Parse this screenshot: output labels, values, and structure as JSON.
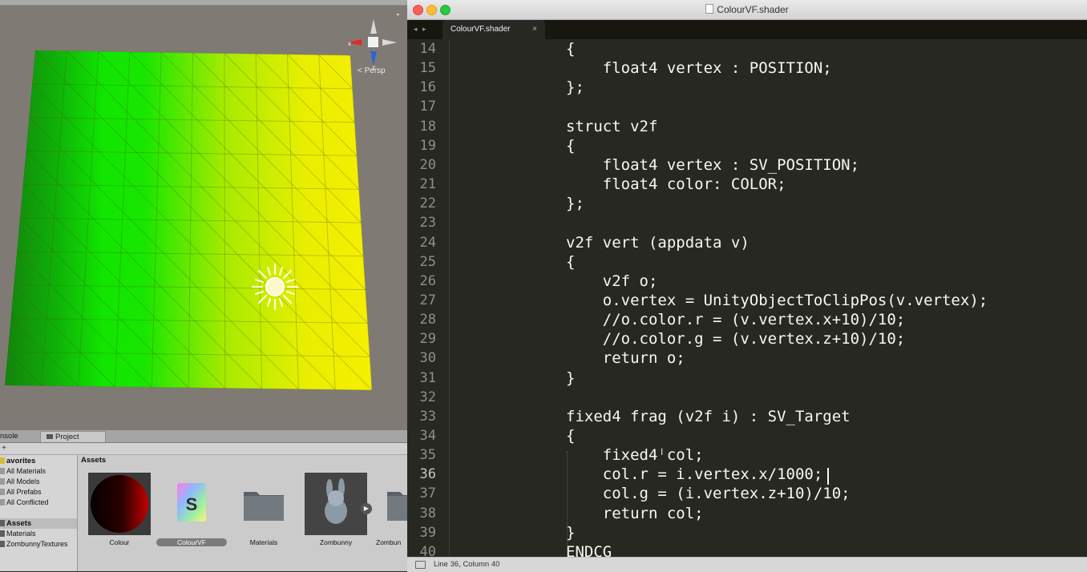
{
  "unity": {
    "scene": {
      "persp_label": "< Persp",
      "gizmo_axes": [
        "x",
        "y",
        "z"
      ]
    },
    "panel_tabs": [
      "nsole",
      "Project"
    ],
    "toolbar_plus": "+",
    "sidebar": {
      "favorites_header": "avorites",
      "favorites": [
        "All Materials",
        "All Models",
        "All Prefabs",
        "All Conflicted"
      ],
      "assets_header": "Assets",
      "folders": [
        "Materials",
        "ZombunnyTextures"
      ]
    },
    "assets": {
      "title": "Assets",
      "items": [
        {
          "label": "Colour",
          "icon": "material-sphere-icon"
        },
        {
          "label": "ColourVF",
          "icon": "shader-file-icon",
          "selected": true
        },
        {
          "label": "Materials",
          "icon": "folder-icon"
        },
        {
          "label": "Zombunny",
          "icon": "model-icon"
        },
        {
          "label": "Zombun",
          "icon": "folder-icon"
        }
      ]
    },
    "colors": {
      "gradient_dark_green": "#1a9a0f",
      "gradient_green": "#12e000",
      "gradient_yellow": "#f3f000"
    }
  },
  "editor": {
    "window_title": "ColourVF.shader",
    "tab_nav": "◂ ▸",
    "tab": {
      "label": "ColourVF.shader",
      "close": "×"
    },
    "lines": [
      {
        "num": "14",
        "code": "{"
      },
      {
        "num": "15",
        "code": "    float4 vertex : POSITION;"
      },
      {
        "num": "16",
        "code": "};"
      },
      {
        "num": "17",
        "code": ""
      },
      {
        "num": "18",
        "code": "struct v2f"
      },
      {
        "num": "19",
        "code": "{"
      },
      {
        "num": "20",
        "code": "    float4 vertex : SV_POSITION;"
      },
      {
        "num": "21",
        "code": "    float4 color: COLOR;"
      },
      {
        "num": "22",
        "code": "};"
      },
      {
        "num": "23",
        "code": ""
      },
      {
        "num": "24",
        "code": "v2f vert (appdata v)"
      },
      {
        "num": "25",
        "code": "{"
      },
      {
        "num": "26",
        "code": "    v2f o;"
      },
      {
        "num": "27",
        "code": "    o.vertex = UnityObjectToClipPos(v.vertex);"
      },
      {
        "num": "28",
        "code": "    //o.color.r = (v.vertex.x+10)/10;"
      },
      {
        "num": "29",
        "code": "    //o.color.g = (v.vertex.z+10)/10;"
      },
      {
        "num": "30",
        "code": "    return o;"
      },
      {
        "num": "31",
        "code": "}"
      },
      {
        "num": "32",
        "code": ""
      },
      {
        "num": "33",
        "code": "fixed4 frag (v2f i) : SV_Target"
      },
      {
        "num": "34",
        "code": "{"
      },
      {
        "num": "35",
        "code": "    fixed4 col;"
      },
      {
        "num": "36",
        "code": "    col.r = i.vertex.x/1000;"
      },
      {
        "num": "37",
        "code": "    col.g = (i.vertex.z+10)/10;"
      },
      {
        "num": "38",
        "code": "    return col;"
      },
      {
        "num": "39",
        "code": "}"
      },
      {
        "num": "40",
        "code": "ENDCG"
      }
    ],
    "current_line": "36",
    "status": "Line 36, Column 40",
    "colors": {
      "background": "#272822",
      "text": "#f8f8f2",
      "line_number": "#8f908a"
    }
  }
}
